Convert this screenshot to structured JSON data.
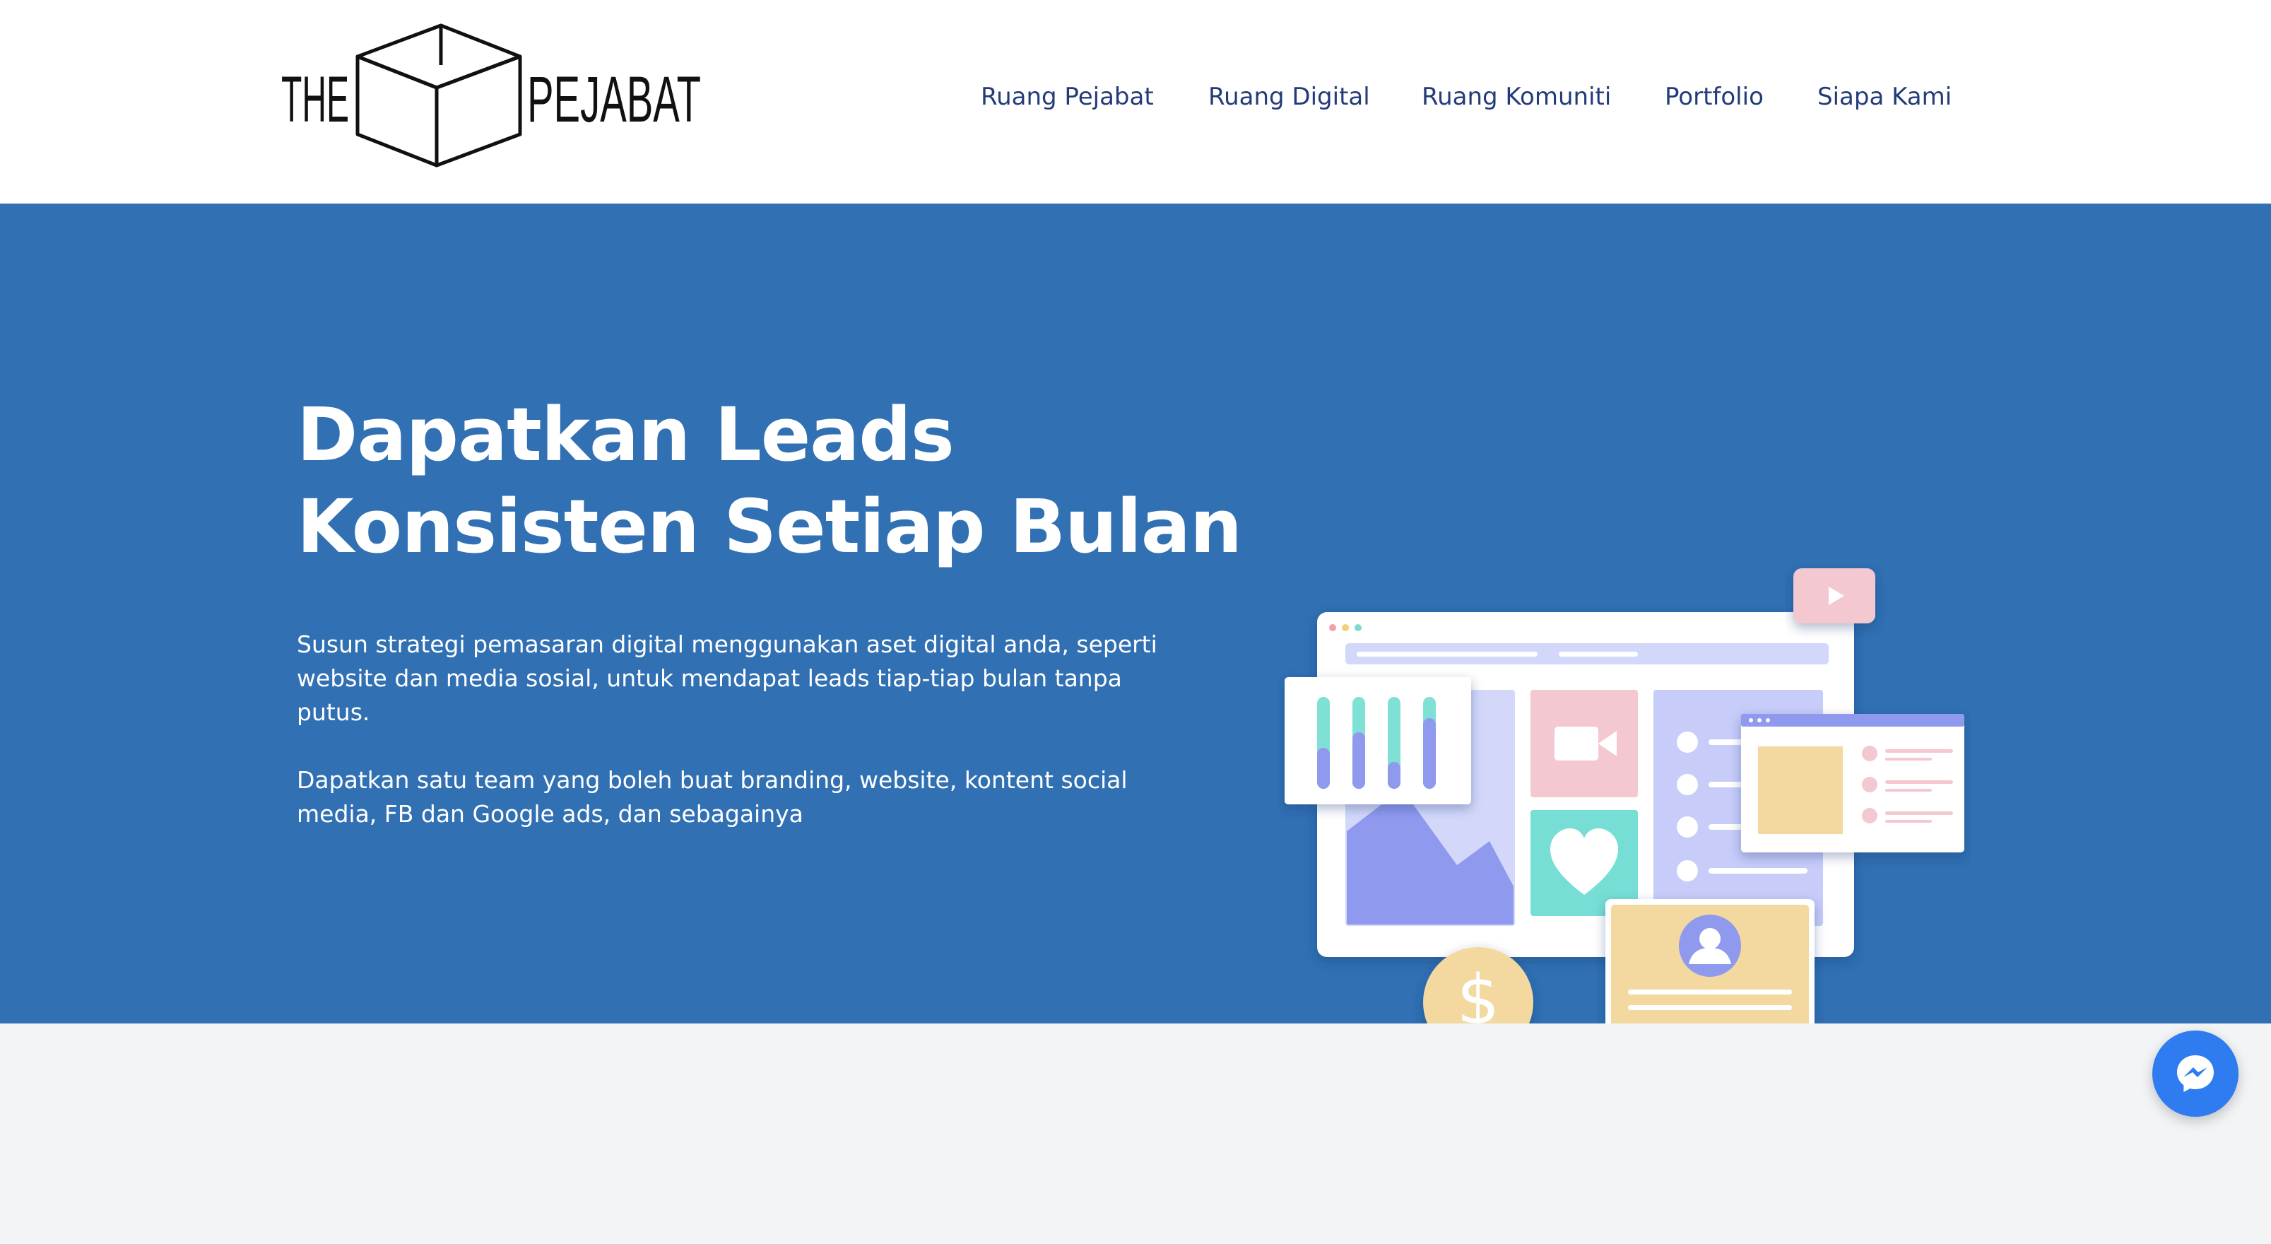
{
  "logo": {
    "left_text": "THE",
    "right_text": "PEJABAT"
  },
  "nav": {
    "items": [
      {
        "label": "Ruang Pejabat"
      },
      {
        "label": "Ruang Digital"
      },
      {
        "label": "Ruang Komuniti"
      },
      {
        "label": "Portfolio"
      },
      {
        "label": "Siapa Kami"
      }
    ]
  },
  "hero": {
    "title_line_1": "Dapatkan Leads",
    "title_line_2": "Konsisten Setiap Bulan",
    "para_1_line_1": "Susun strategi pemasaran digital menggunakan aset digital anda, seperti",
    "para_1_line_2": "website dan media sosial, untuk mendapat leads tiap-tiap bulan tanpa",
    "para_1_line_3": "putus.",
    "para_2_line_1": "Dapatkan satu team yang boleh buat branding, website, kontent social",
    "para_2_line_2": "media, FB dan Google ads, dan sebagainya"
  },
  "colors": {
    "hero_background": "#3070b3",
    "nav_text": "#233b79",
    "page_background": "#f3f4f6",
    "messenger": "#2f7cf0"
  },
  "icons": {
    "chat": "messenger-icon",
    "currency": "dollar-icon",
    "video": "camera-icon",
    "like": "heart-icon",
    "play": "play-icon",
    "user": "avatar-icon"
  }
}
